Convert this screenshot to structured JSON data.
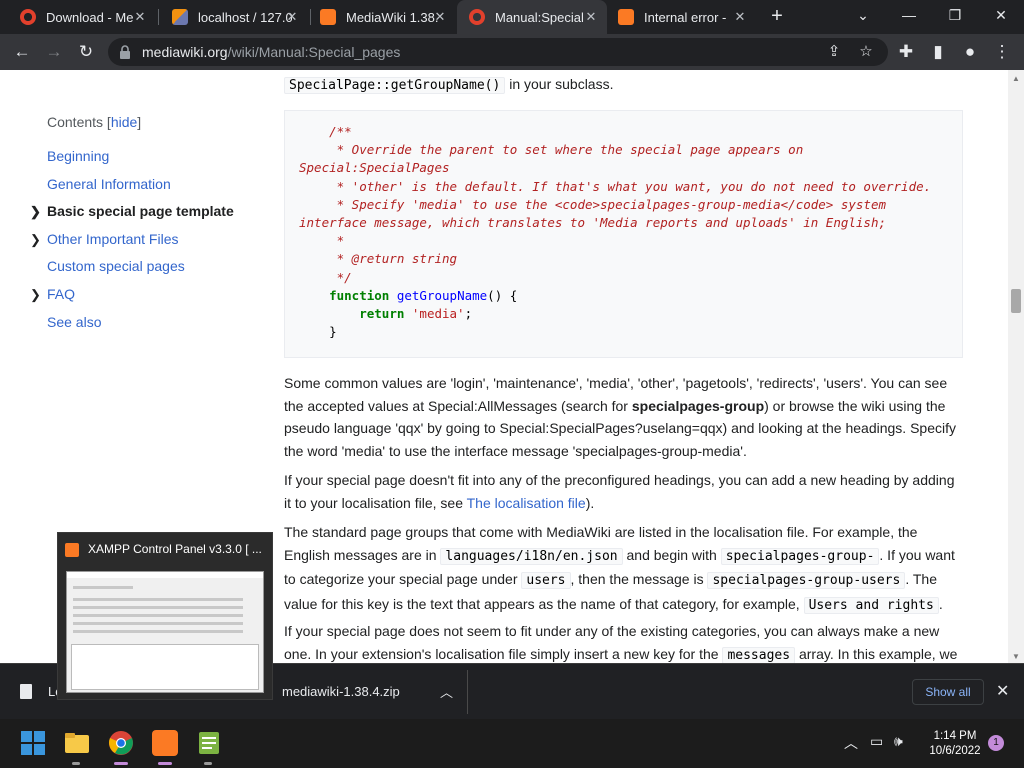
{
  "browser": {
    "tabs": [
      {
        "title": "Download - Me",
        "favicon": "opera-icon",
        "color": "#e2402c",
        "active": false
      },
      {
        "title": "localhost / 127.0",
        "favicon": "phpmyadmin-icon",
        "color": "#f29111",
        "active": false
      },
      {
        "title": "MediaWiki 1.38.",
        "favicon": "xampp-icon",
        "color": "#fb7a24",
        "active": false
      },
      {
        "title": "Manual:Special",
        "favicon": "opera-icon",
        "color": "#e2402c",
        "active": true
      },
      {
        "title": "Internal error -",
        "favicon": "xampp-icon",
        "color": "#fb7a24",
        "active": false
      }
    ],
    "url_host": "mediawiki.org",
    "url_path": "/wiki/Manual:Special_pages"
  },
  "toc": {
    "heading": "Contents",
    "toggle": "hide",
    "items": [
      {
        "label": "Beginning",
        "chevron": false,
        "bold": false
      },
      {
        "label": "General Information",
        "chevron": false,
        "bold": false
      },
      {
        "label": "Basic special page template",
        "chevron": true,
        "bold": true
      },
      {
        "label": "Other Important Files",
        "chevron": true,
        "bold": false
      },
      {
        "label": "Custom special pages",
        "chevron": false,
        "bold": false
      },
      {
        "label": "FAQ",
        "chevron": true,
        "bold": false
      },
      {
        "label": "See also",
        "chevron": false,
        "bold": false
      }
    ]
  },
  "article": {
    "intro_code": "SpecialPage::getGroupName()",
    "intro_text": " in your subclass.",
    "code_lines": [
      "    /**",
      "     * Override the parent to set where the special page appears on",
      "Special:SpecialPages",
      "     * 'other' is the default. If that's what you want, you do not need to override.",
      "     * Specify 'media' to use the <code>specialpages-group-media</code> system",
      "interface message, which translates to 'Media reports and uploads' in English;",
      "     *",
      "     * @return string",
      "     */"
    ],
    "code_kw_function": "function",
    "code_fn_name": "getGroupName",
    "code_fn_args": "() {",
    "code_kw_return": "return",
    "code_return_val": "'media'",
    "code_semicolon": ";",
    "code_close": "    }",
    "para1_a": "Some common values are 'login', 'maintenance', 'media', 'other', 'pagetools', 'redirects', 'users'. You can see the accepted values at Special:AllMessages (search for ",
    "para1_b": "specialpages-group",
    "para1_c": ") or browse the wiki using the pseudo language 'qqx' by going to Special:SpecialPages?uselang=qqx) and looking at the headings. Specify the word 'media' to use the interface message 'specialpages-group-media'.",
    "para2_a": "If your special page doesn't fit into any of the preconfigured headings, you can add a new heading by adding it to your localisation file, see ",
    "para2_link": "The localisation file",
    "para2_c": ").",
    "para3_a": "The standard page groups that come with MediaWiki are listed in the localisation file. For example, the English messages are in ",
    "para3_code1": "languages/i18n/en.json",
    "para3_b": " and begin with ",
    "para3_code2": "specialpages-group-",
    "para3_c": ". If you want to categorize your special page under ",
    "para3_code3": "users",
    "para3_d": ", then the message is ",
    "para3_code4": "specialpages-group-users",
    "para3_e": ". The value for this key is the text that appears as the name of that category, for example, ",
    "para3_code5": "Users and rights",
    "para3_f": ".",
    "para4_a": "If your special page does not seem to fit under any of the existing categories, you can always make a new one. In your extension's localisation file simply insert a new key for the ",
    "para4_code": "messages",
    "para4_b": " array. In this example, we"
  },
  "preview": {
    "title": "XAMPP Control Panel v3.3.0   [ ..."
  },
  "downloads": {
    "file1": "Lo",
    "file2": "mediawiki-1.38.4.zip",
    "show_all": "Show all"
  },
  "taskbar": {
    "time": "1:14 PM",
    "date": "10/6/2022",
    "notifications": "1",
    "apps": [
      {
        "name": "start-icon",
        "color": "#3a96dd"
      },
      {
        "name": "file-explorer-icon",
        "color": "#f7c948"
      },
      {
        "name": "chrome-icon",
        "color": "#1a73e8"
      },
      {
        "name": "xampp-icon",
        "color": "#fb7a24"
      },
      {
        "name": "notepad-icon",
        "color": "#7cb342"
      }
    ]
  }
}
